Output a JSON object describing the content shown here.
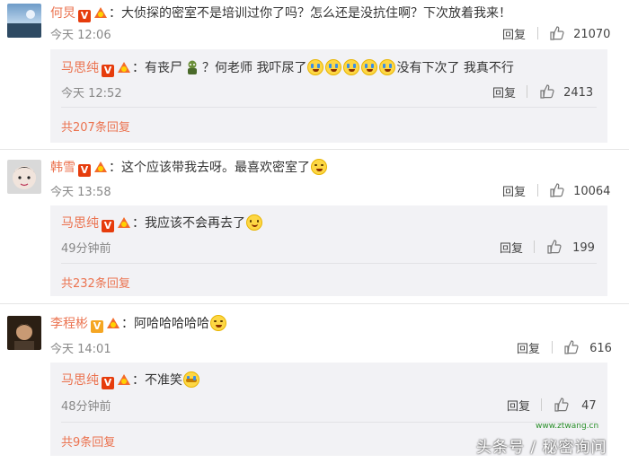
{
  "colors": {
    "accent": "#eb7350",
    "vip": "#e63c0c",
    "subbg": "#f2f2f5"
  },
  "comments": [
    {
      "user": "何炅",
      "text": "：大侦探的密室不是培训过你了吗？怎么还是没抗住啊？下次放着我来！",
      "time": "今天 12:06",
      "reply": "回复",
      "likes": "21070",
      "subreply": {
        "user": "马思纯",
        "text_before": "：有丧尸",
        "text_mid": "？何老师 我吓尿了",
        "text_after": "没有下次了 我真不行",
        "time": "今天 12:52",
        "reply": "回复",
        "likes": "2413"
      },
      "more": "共207条回复"
    },
    {
      "user": "韩雪",
      "text": "：这个应该带我去呀。最喜欢密室了",
      "time": "今天 13:58",
      "reply": "回复",
      "likes": "10064",
      "subreply": {
        "user": "马思纯",
        "text": "：我应该不会再去了",
        "time": "49分钟前",
        "reply": "回复",
        "likes": "199"
      },
      "more": "共232条回复"
    },
    {
      "user": "李程彬",
      "text": "：阿哈哈哈哈哈",
      "time": "今天 14:01",
      "reply": "回复",
      "likes": "616",
      "subreply": {
        "user": "马思纯",
        "text": "：不准笑",
        "time": "48分钟前",
        "reply": "回复",
        "likes": "47"
      },
      "more": "共9条回复"
    }
  ],
  "vip_letter": "V",
  "watermark": "头条号 / 秘密询问",
  "watermark2": "www.ztwang.cn",
  "icons": {
    "thumb": "thumbs-up-icon",
    "level": "level-icon",
    "zombie": "zombie-icon"
  }
}
